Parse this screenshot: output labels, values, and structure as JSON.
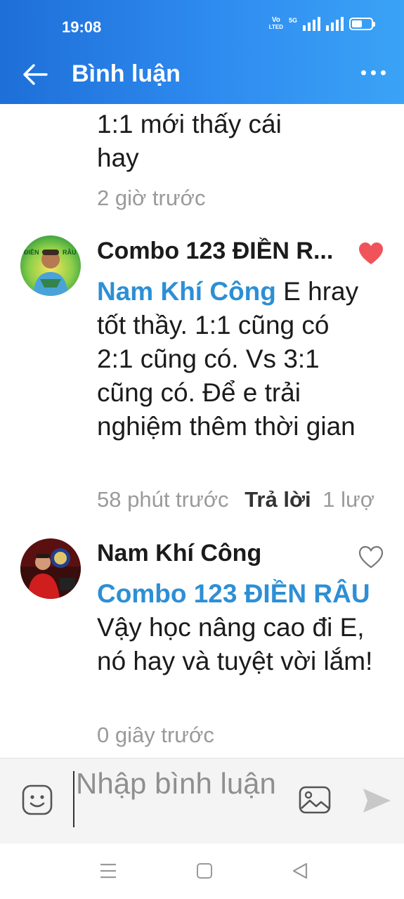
{
  "status_bar": {
    "time": "19:08",
    "network_top": "Vo",
    "network_bottom": "LTED",
    "network_type": "5G"
  },
  "header": {
    "title": "Bình luận",
    "back_icon": "arrow-left-icon",
    "menu_icon": "more-dots-icon"
  },
  "comments": [
    {
      "body_lines": [
        "1:1 mới thấy cái",
        "hay"
      ],
      "time": "2 giờ trước"
    },
    {
      "author": "Combo 123 ĐIỀN R...",
      "mention": "Nam Khí Công",
      "text": " E hray tốt thầy. 1:1 cũng có 2:1 cũng có. Vs 3:1 cũng có. Để e trải nghiệm thêm thời gian",
      "time": "58 phút trước",
      "reply_label": "Trả lời",
      "replies": "1 lượ",
      "liked": true,
      "avatar_text": "ĐIỀN RÂU"
    },
    {
      "author": "Nam Khí Công",
      "mention": "Combo 123 ĐIỀN RÂU",
      "text": " Vậy học nâng cao đi E, nó hay và tuyệt vời lắm!",
      "time": "0 giây trước",
      "liked": false
    }
  ],
  "input": {
    "placeholder": "Nhập bình luận"
  },
  "colors": {
    "header_start": "#1e6fd8",
    "header_end": "#3aa3f6",
    "mention": "#2d8fd5",
    "like": "#f0545a",
    "meta": "#9a9a9a"
  }
}
